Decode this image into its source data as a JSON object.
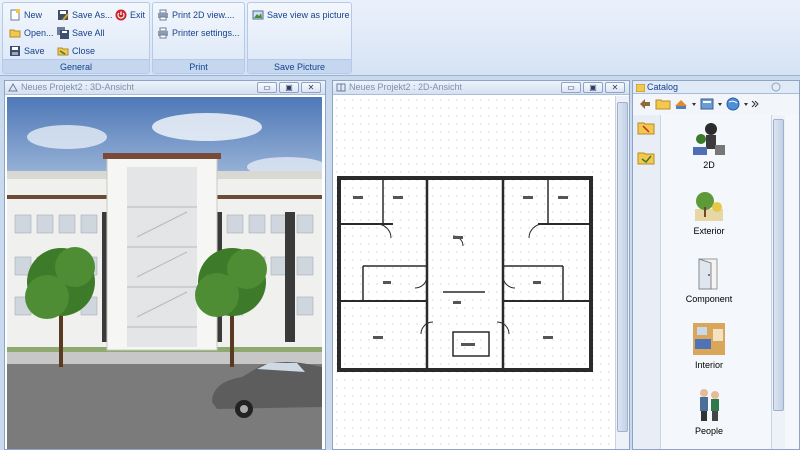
{
  "ribbon": {
    "groups": [
      {
        "label": "General"
      },
      {
        "label": "Print"
      },
      {
        "label": "Save Picture"
      }
    ],
    "general": {
      "new": "New",
      "open": "Open...",
      "save": "Save",
      "save_as": "Save As...",
      "save_all": "Save All",
      "close": "Close",
      "exit": "Exit"
    },
    "print": {
      "print2d": "Print 2D view....",
      "printer_settings": "Printer settings..."
    },
    "save_picture": {
      "save_view": "Save view as picture"
    }
  },
  "view3d": {
    "title": "Neues Projekt2 : 3D-Ansicht"
  },
  "view2d": {
    "title": "Neues Projekt2 : 2D-Ansicht"
  },
  "catalog": {
    "title": "Catalog",
    "items": [
      {
        "label": "2D"
      },
      {
        "label": "Exterior"
      },
      {
        "label": "Component"
      },
      {
        "label": "Interior"
      },
      {
        "label": "People"
      }
    ]
  },
  "window_buttons": {
    "minimize": "▭",
    "restore": "▣",
    "close": "✕"
  },
  "colors": {
    "accent": "#15428b",
    "ribbon_bg": "#dae6f6",
    "sky": "#5f88c6",
    "road": "#7b7b7b"
  }
}
